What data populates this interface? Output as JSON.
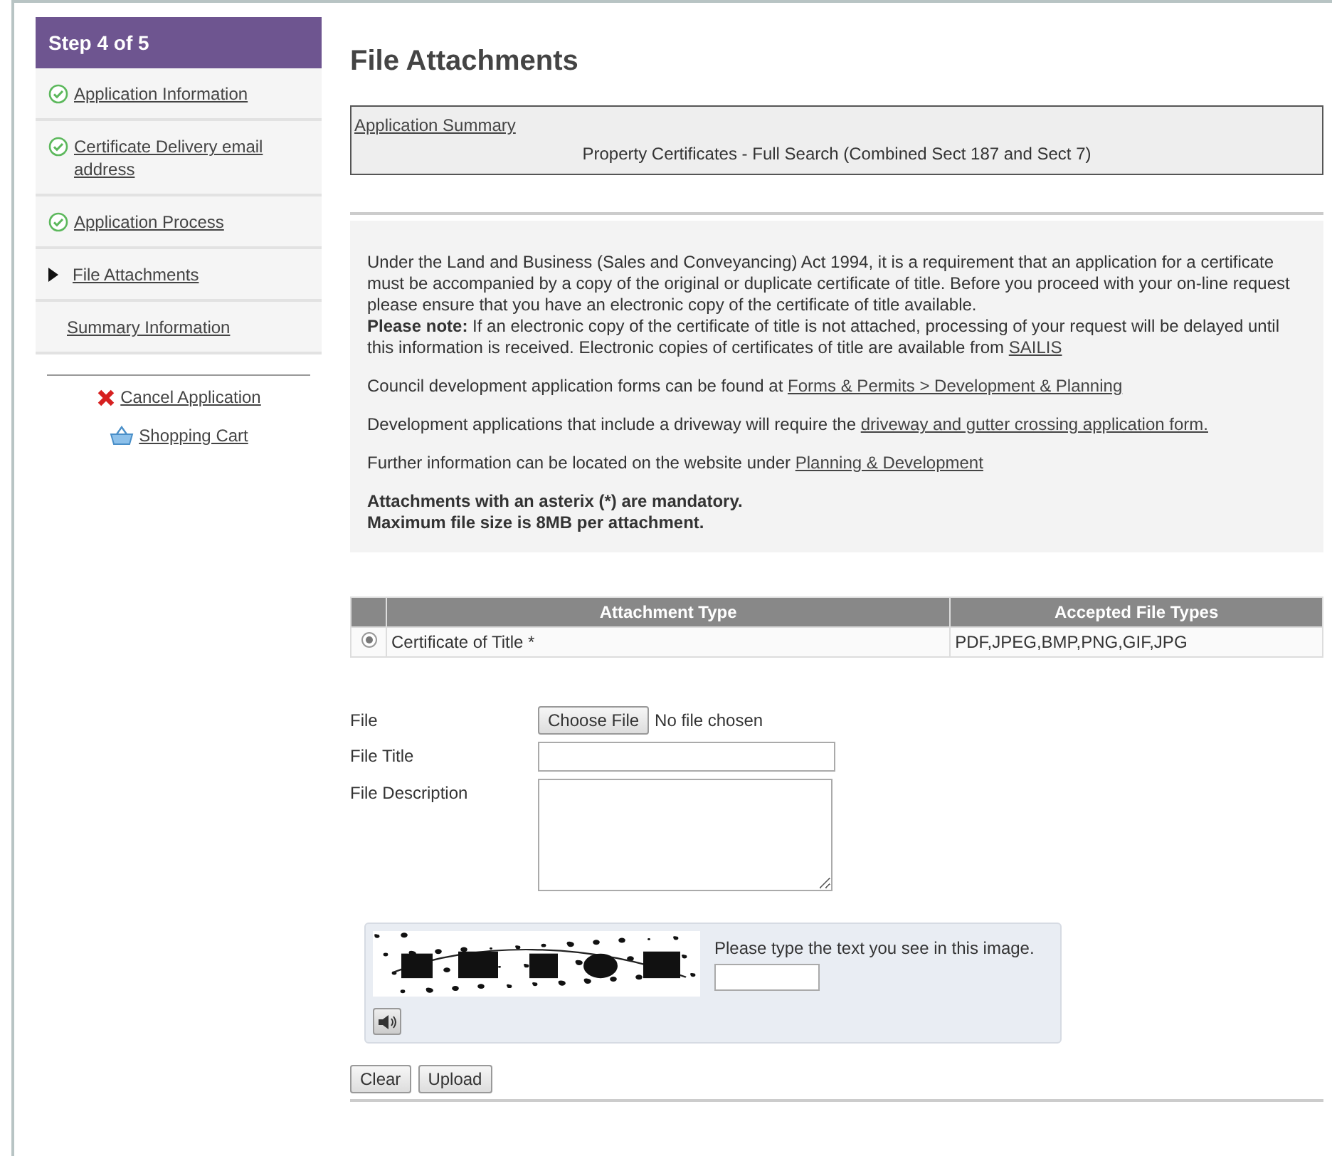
{
  "sidebar": {
    "header": "Step 4 of 5",
    "steps": [
      {
        "label": "Application Information",
        "kind": "done"
      },
      {
        "label": "Certificate Delivery email address",
        "kind": "done"
      },
      {
        "label": "Application Process",
        "kind": "done"
      },
      {
        "label": "File Attachments",
        "kind": "current"
      },
      {
        "label": "Summary Information",
        "kind": "pending"
      }
    ],
    "actions": [
      {
        "label": "Cancel Application",
        "kind": "cancel"
      },
      {
        "label": "Shopping Cart",
        "kind": "cart"
      }
    ]
  },
  "page_title": "File Attachments",
  "summary": {
    "link": "Application Summary",
    "text": "Property Certificates - Full Search (Combined Sect 187 and Sect 7)"
  },
  "info": {
    "paragraphs": [
      {
        "text": "Under the Land and Business (Sales and Conveyancing) Act 1994, it is a requirement that an application for a certificate must be accompanied by a copy of the original or duplicate certificate of title. Before you proceed with your on-line request please ensure that you have an electronic copy of the certificate of title available.\n**Please note:** If an electronic copy of the certificate of title is not attached, processing of your request will be delayed until this information is received. Electronic copies of certificates of title are available from ",
        "link": "SAILIS"
      },
      {
        "text": "Council development application forms can be found at ",
        "link": "Forms & Permits > Development & Planning"
      },
      {
        "text": "Development applications that include a driveway will require the ",
        "link": "driveway and gutter crossing application form."
      },
      {
        "text": "Further information can be located on the website under ",
        "link": "Planning & Development"
      }
    ],
    "notes": [
      "Attachments with an asterix (*) are mandatory.",
      "Maximum file size is 8MB per attachment."
    ]
  },
  "table": {
    "columns": [
      "Attachment Type",
      "Accepted File Types"
    ],
    "rows": [
      {
        "type": "Certificate of Title *",
        "file_types": "PDF,JPEG,BMP,PNG,GIF,JPG",
        "selected": true
      }
    ]
  },
  "form": {
    "file_label": "File",
    "choose_button": "Choose File",
    "file_status": "No file chosen",
    "title_label": "File Title",
    "description_label": "File Description"
  },
  "captcha": {
    "prompt": "Please type the text you see in this image."
  },
  "buttons": [
    "Clear",
    "Upload"
  ]
}
